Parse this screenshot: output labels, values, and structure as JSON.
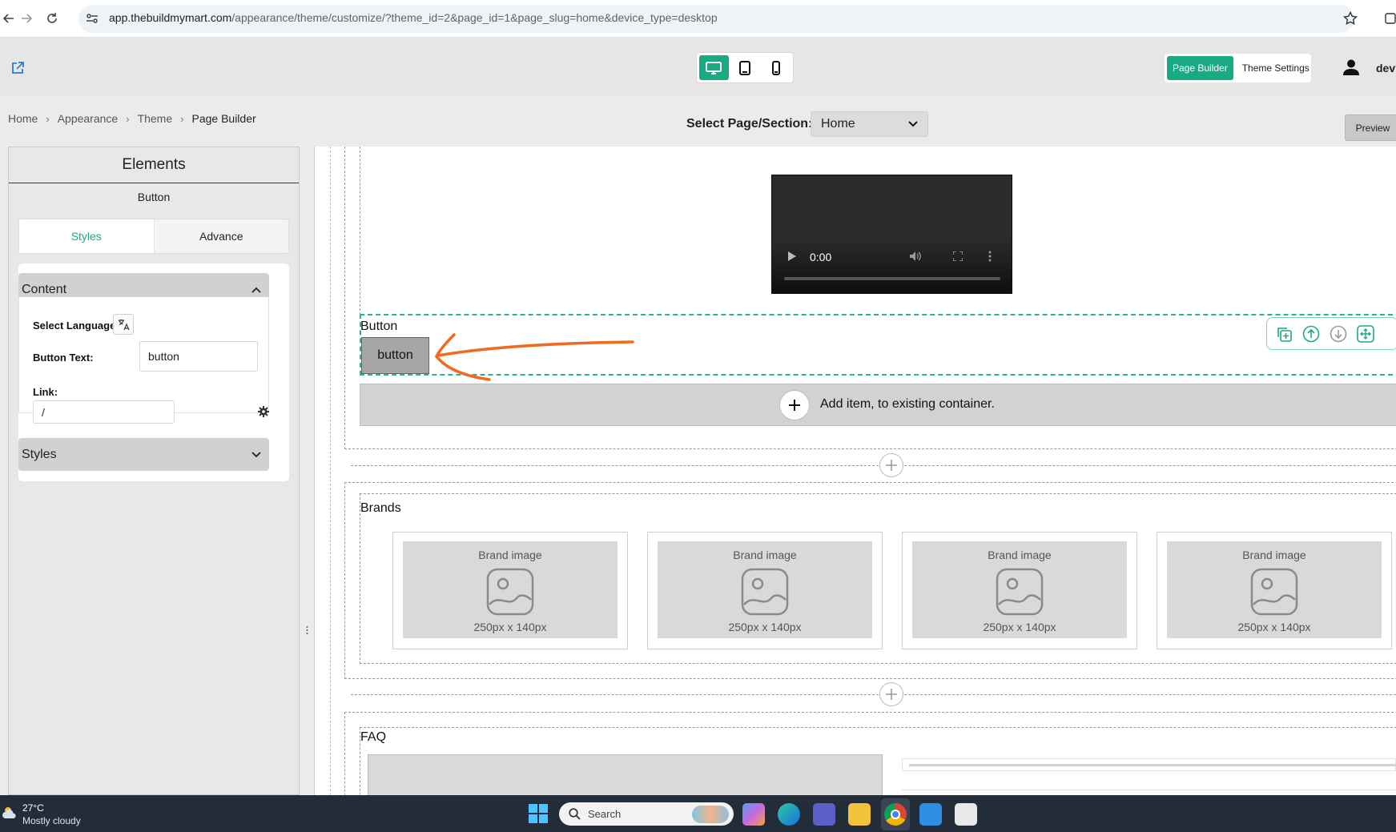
{
  "browser": {
    "url_domain": "app.thebuildmymart.com",
    "url_path": "/appearance/theme/customize/?theme_id=2&page_id=1&page_slug=home&device_type=desktop"
  },
  "header": {
    "mode_active": "Page Builder",
    "mode_other": "Theme Settings",
    "user_name": "dev"
  },
  "breadcrumb": [
    "Home",
    "Appearance",
    "Theme",
    "Page Builder"
  ],
  "page_select": {
    "label": "Select Page/Section:",
    "value": "Home"
  },
  "preview_label": "Preview",
  "left_panel": {
    "title": "Elements",
    "subtitle": "Button",
    "tabs": [
      "Styles",
      "Advance"
    ],
    "content_header": "Content",
    "select_language_label": "Select Language",
    "button_text_label": "Button Text:",
    "button_text_value": "button",
    "link_label": "Link:",
    "link_value": "/",
    "styles_header": "Styles"
  },
  "canvas": {
    "video_time": "0:00",
    "button_section_title": "Button",
    "button_label": "button",
    "add_item_label": "Add item, to existing container.",
    "brands_title": "Brands",
    "brand_cards": [
      {
        "title": "Brand image",
        "size": "250px x 140px"
      },
      {
        "title": "Brand image",
        "size": "250px x 140px"
      },
      {
        "title": "Brand image",
        "size": "250px x 140px"
      },
      {
        "title": "Brand image",
        "size": "250px x 140px"
      }
    ],
    "faq_title": "FAQ"
  },
  "taskbar": {
    "temperature": "27°C",
    "weather": "Mostly cloudy",
    "search_label": "Search"
  },
  "colors": {
    "accent": "#1aaa83",
    "annotation": "#f06a1f"
  }
}
